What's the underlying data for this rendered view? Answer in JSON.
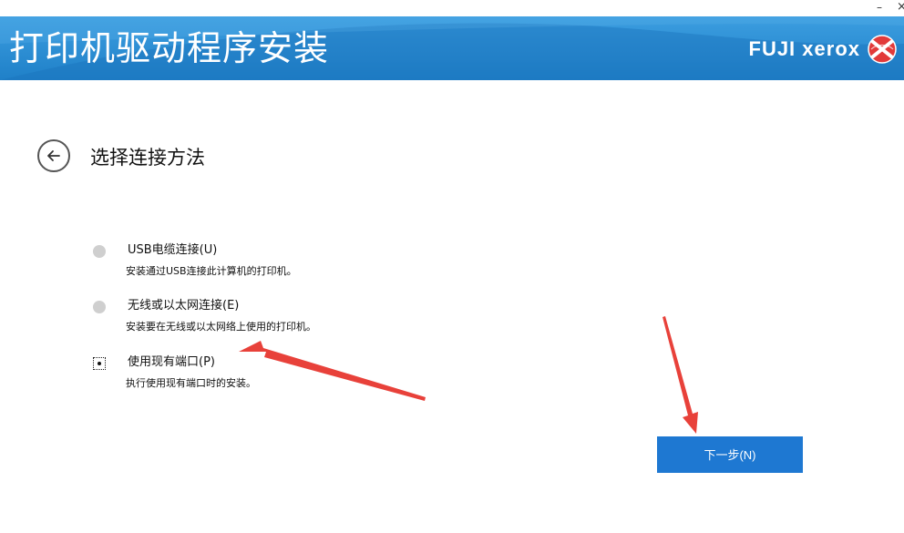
{
  "window": {
    "minimize_glyph": "–",
    "close_glyph": "×"
  },
  "header": {
    "title": "打印机驱动程序安装",
    "brand_name": "FUJI xerox",
    "brand_logo_icon": "fuji-xerox-sphere-icon",
    "background_color": "#2a8dd6"
  },
  "main": {
    "back_icon": "arrow-left-icon",
    "heading": "选择连接方法"
  },
  "options": [
    {
      "label": "USB电缆连接(U)",
      "description": "安装通过USB连接此计算机的打印机。",
      "selected": false
    },
    {
      "label": "无线或以太网连接(E)",
      "description": "安装要在无线或以太网络上使用的打印机。",
      "selected": false
    },
    {
      "label": "使用现有端口(P)",
      "description": "执行使用现有端口时的安装。",
      "selected": true
    }
  ],
  "footer": {
    "next_label": "下一步(N)",
    "next_color": "#1e78d2"
  },
  "annotation_color": "#e8413a"
}
